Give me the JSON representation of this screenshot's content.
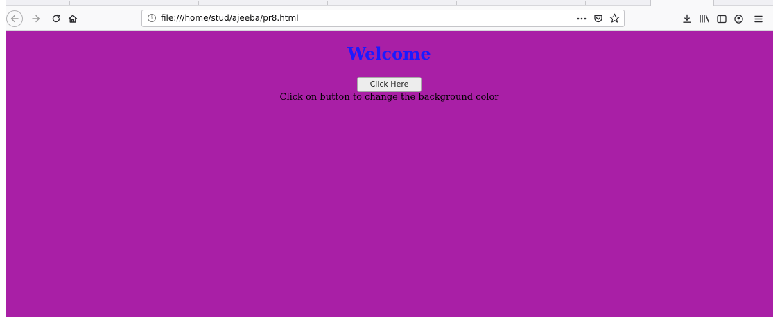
{
  "browser": {
    "url": "file:///home/stud/ajeeba/pr8.html",
    "icons": {
      "back": "back-arrow-icon",
      "forward": "forward-arrow-icon",
      "reload": "reload-icon",
      "home": "home-icon",
      "info": "info-icon",
      "more": "more-actions-icon",
      "pocket": "pocket-icon",
      "bookmark": "bookmark-star-icon",
      "download": "download-icon",
      "library": "library-icon",
      "sidebar": "sidebar-icon",
      "account": "account-icon",
      "menu": "hamburger-menu-icon"
    }
  },
  "page": {
    "heading": "Welcome",
    "button_label": "Click Here",
    "hint_text": "Click on button to change the background color",
    "background_color": "#a91fa6",
    "heading_color": "#1a1aff"
  }
}
